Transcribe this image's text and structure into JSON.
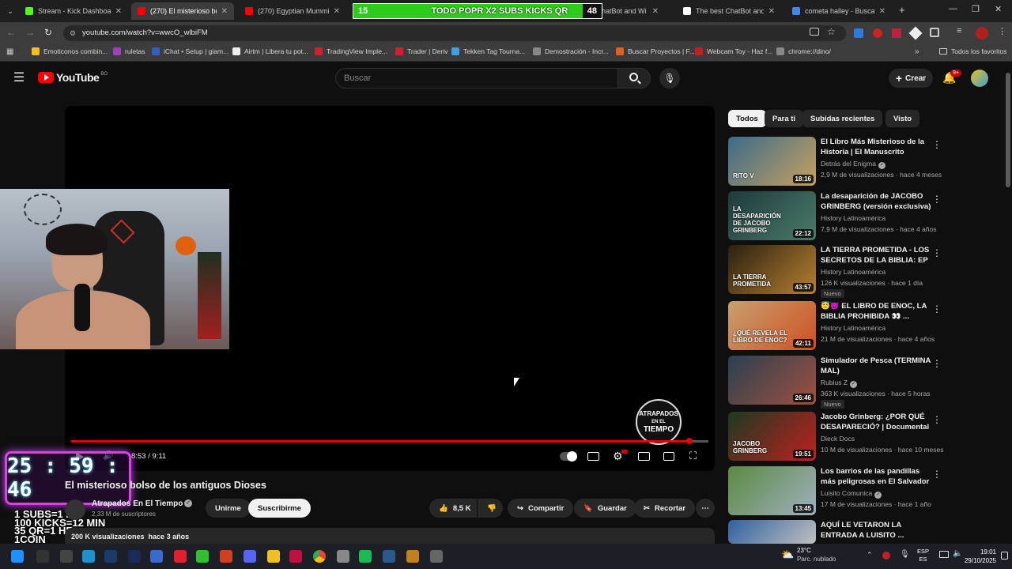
{
  "browser": {
    "tabs": [
      {
        "label": "Stream - Kick Dashboard",
        "color": "#53fc18"
      },
      {
        "label": "(270) El misterioso bolso d",
        "color": "#ff0000"
      },
      {
        "label": "(270) Egyptian Mummies",
        "color": "#ff0000"
      },
      {
        "label": "est ChatBot and Wi",
        "color": "#888888"
      },
      {
        "label": "The best ChatBot and Wi",
        "color": "#ffffff"
      },
      {
        "label": "cometa halley - Buscar c",
        "color": "#4285f4"
      }
    ],
    "overlay_banner": {
      "left": "15",
      "text": "TODO POPR X2 SUBS KICKS QR",
      "right": "48"
    },
    "url": "youtube.com/watch?v=wwcO_wlbiFM",
    "bookmarks": [
      "Emoticonos combin...",
      "ruletas",
      "iChat • Setup | giam...",
      "Airtm | Libera tu pot...",
      "TradingView Imple...",
      "Trader | Deriv",
      "Tekken Tag Tourna...",
      "Demostración - Incr...",
      "Buscar Proyectos | F...",
      "Webcam Toy - Haz f...",
      "chrome://dino/"
    ],
    "bookmarks_all": "Todos los favoritos"
  },
  "youtube": {
    "logo_text": "YouTube",
    "logo_suffix": "BO",
    "search_placeholder": "Buscar",
    "create_label": "Crear",
    "notif_count": "9+"
  },
  "player": {
    "time": "8:53 / 9:11",
    "watermark": [
      "ATRAPADOS",
      "EN EL",
      "TIEMPO"
    ],
    "progress": 0.97
  },
  "video": {
    "title": "El misterioso bolso de los antiguos Dioses",
    "channel": "Atrapados En El Tiempo",
    "subs": "2,33 M de suscriptores",
    "join_label": "Unirme",
    "subscribe_label": "Suscribirme",
    "likes": "8,5 K",
    "share_label": "Compartir",
    "save_label": "Guardar",
    "clip_label": "Recortar",
    "views_line": "200 K visualizaciones  hace 3 años"
  },
  "stream_overlay": {
    "timer": "25 : 59 : 46",
    "lines": [
      "1 SUBS=1 HR",
      "100 KICKS=12 MIN",
      "35 QR=1 HR",
      "1COIN"
    ]
  },
  "chips": [
    "Todos",
    "Para ti",
    "Subidas recientes",
    "Visto"
  ],
  "recommended": [
    {
      "title": "El Libro Más Misterioso de la Historia | El Manuscrito Voynich",
      "channel": "Detrás del Enigma",
      "verified": true,
      "meta": "2,9 M de visualizaciones · hace 4 meses",
      "duration": "18:16",
      "badge": "",
      "thumb_text": "RITO V",
      "c1": "#3a6b8a",
      "c2": "#c8a060"
    },
    {
      "title": "La desaparición de JACOBO GRINBERG (versión exclusiva) ...",
      "channel": "History Latinoamérica",
      "verified": false,
      "meta": "7,9 M de visualizaciones · hace 4 años",
      "duration": "22:12",
      "badge": "",
      "thumb_text": "LA DESAPARICIÓN DE JACOBO GRINBERG",
      "c1": "#1f3a3a",
      "c2": "#4a7a6a"
    },
    {
      "title": "LA TIERRA PROMETIDA - LOS SECRETOS DE LA BIBLIA: EP 0...",
      "channel": "History Latinoamérica",
      "verified": false,
      "meta": "126 K visualizaciones · hace 1 día",
      "duration": "43:57",
      "badge": "Nuevo",
      "thumb_text": "LA TIERRA PROMETIDA",
      "c1": "#2a2010",
      "c2": "#b88030"
    },
    {
      "title": "😇😈 EL LIBRO DE ENOC, LA BIBLIA PROHIBIDA 👀 ...",
      "channel": "History Latinoamérica",
      "verified": false,
      "meta": "21 M de visualizaciones · hace 4 años",
      "duration": "42:11",
      "badge": "",
      "thumb_text": "¿QUÉ REVELA EL LIBRO DE ENOC?",
      "c1": "#c8a070",
      "c2": "#d05020"
    },
    {
      "title": "Simulador de Pesca (TERMINA MAL)",
      "channel": "Rubius Z",
      "verified": true,
      "meta": "363 K visualizaciones · hace 5 horas",
      "duration": "26:46",
      "badge": "Nuevo",
      "thumb_text": "",
      "c1": "#2a4050",
      "c2": "#a05040"
    },
    {
      "title": "Jacobo Grinberg: ¿POR QUÉ DESAPARECIÓ? | Documental",
      "channel": "Dieck Docs",
      "verified": false,
      "meta": "10 M de visualizaciones · hace 10 meses",
      "duration": "19:51",
      "badge": "",
      "thumb_text": "JACOBO GRINBERG",
      "c1": "#1a3a20",
      "c2": "#c02020"
    },
    {
      "title": "Los barrios de las pandillas más peligrosas en El Salvador | ...",
      "channel": "Luisito Comunica",
      "verified": true,
      "meta": "17 M de visualizaciones · hace 1 año",
      "duration": "13:45",
      "badge": "",
      "thumb_text": "",
      "c1": "#5a8a40",
      "c2": "#a0b0c0"
    },
    {
      "title": "AQUÍ LE VETARON LA ENTRADA A LUISITO ...",
      "channel": "",
      "verified": false,
      "meta": "",
      "duration": "",
      "badge": "",
      "thumb_text": "",
      "c1": "#3060a0",
      "c2": "#c0c0c0"
    }
  ],
  "taskbar": {
    "weather_temp": "23°C",
    "weather_text": "Parc. nublado",
    "lang_1": "ESP",
    "lang_2": "ES",
    "time": "19:01",
    "date": "29/10/2025"
  }
}
